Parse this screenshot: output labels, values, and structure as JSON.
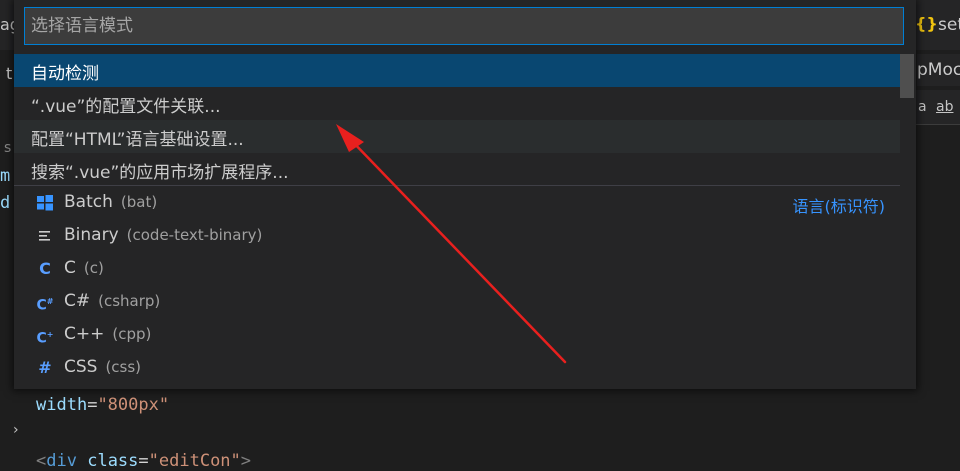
{
  "background": {
    "left_fragments": [
      "ag",
      "t",
      "s",
      "m",
      "d"
    ],
    "right_fragments": {
      "braces": "{}",
      "tab1": "set",
      "tab2": "pMoc",
      "find_case": "a",
      "find_word": "ab"
    },
    "code_line1": {
      "attr": "width",
      "eq": "=",
      "value": "\"800px\""
    },
    "code_line2": {
      "open": "<",
      "tag": "div",
      "attr": "class",
      "eq": "=",
      "value": "\"editCon\"",
      "close": ">"
    }
  },
  "quick_pick": {
    "placeholder": "选择语言模式",
    "value": "",
    "items": [
      {
        "label": "自动检测"
      },
      {
        "label": "“.vue”的配置文件关联..."
      },
      {
        "label": "配置“HTML”语言基础设置..."
      },
      {
        "label": "搜索“.vue”的应用市场扩展程序..."
      }
    ],
    "languages": [
      {
        "name": "Batch",
        "id": "(bat)",
        "icon": "windows-icon",
        "glyph": "",
        "color": "#3794ff"
      },
      {
        "name": "Binary",
        "id": "(code-text-binary)",
        "icon": "lines-icon",
        "glyph": "≡",
        "color": "#cccccc"
      },
      {
        "name": "C",
        "id": "(c)",
        "icon": "c-icon",
        "glyph": "C",
        "color": "#599eff"
      },
      {
        "name": "C#",
        "id": "(csharp)",
        "icon": "csharp-icon",
        "glyph": "C#",
        "color": "#599eff"
      },
      {
        "name": "C++",
        "id": "(cpp)",
        "icon": "cpp-icon",
        "glyph": "C+",
        "color": "#599eff"
      },
      {
        "name": "CSS",
        "id": "(css)",
        "icon": "hash-icon",
        "glyph": "#",
        "color": "#599eff"
      }
    ],
    "group_label": "语言(标识符)",
    "selected_index": 0,
    "hovered_index": 2,
    "colors": {
      "accent": "#007fd4",
      "selected_bg": "#094771",
      "group_label": "#3794ff",
      "annotation_arrow": "#e8201e"
    }
  }
}
